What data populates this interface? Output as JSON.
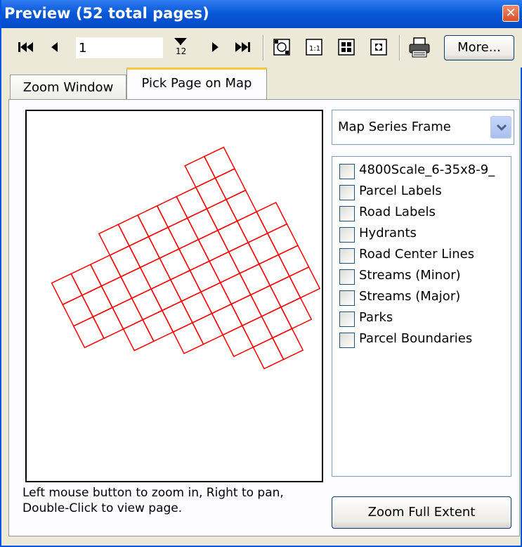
{
  "window": {
    "title": "Preview (52 total pages)",
    "close_icon": "close-icon"
  },
  "toolbar": {
    "first_page_icon": "first-page-icon",
    "prev_page_icon": "previous-page-icon",
    "page_number": "1",
    "goto_page_icon": "go-to-page-icon",
    "goto_page_label": "12",
    "next_page_icon": "next-page-icon",
    "last_page_icon": "last-page-icon",
    "view_icons": [
      "zoom-whole-page-icon",
      "actual-size-icon",
      "fit-width-icon",
      "fit-page-icon"
    ],
    "print_icon": "printer-icon",
    "more_label": "More..."
  },
  "tabs": [
    {
      "label": "Zoom Window",
      "active": false
    },
    {
      "label": "Pick Page on Map",
      "active": true
    }
  ],
  "map": {
    "grid_color": "#ff0000",
    "index_pages": 52
  },
  "hint": {
    "line1": "Left mouse button to zoom in, Right to pan,",
    "line2": "Double-Click to view page."
  },
  "frame_select": {
    "value": "Map Series Frame"
  },
  "layers": [
    {
      "label": "4800Scale_6-35x8-9_",
      "checked": false
    },
    {
      "label": "Parcel Labels",
      "checked": false
    },
    {
      "label": "Road Labels",
      "checked": false
    },
    {
      "label": "Hydrants",
      "checked": false
    },
    {
      "label": "Road Center Lines",
      "checked": false
    },
    {
      "label": "Streams (Minor)",
      "checked": false
    },
    {
      "label": "Streams (Major)",
      "checked": false
    },
    {
      "label": "Parks",
      "checked": false
    },
    {
      "label": "Parcel Boundaries",
      "checked": false
    }
  ],
  "zoom_full_label": "Zoom Full Extent",
  "colors": {
    "title_bar": "#0a59d8",
    "window_face": "#ece9d8",
    "tab_highlight": "#ffc83c"
  }
}
